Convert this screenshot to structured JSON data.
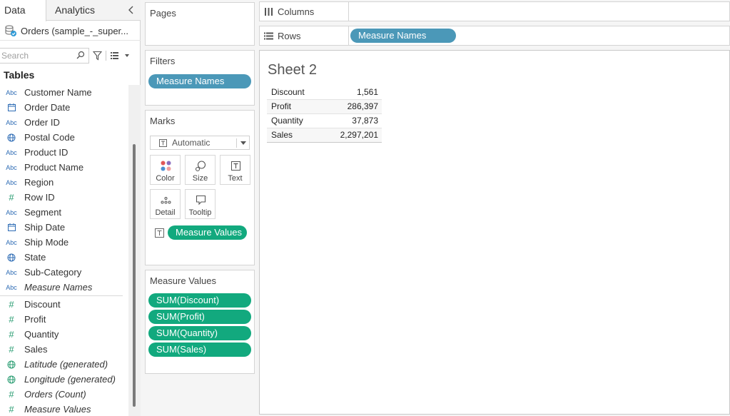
{
  "data_pane": {
    "tabs": [
      "Data",
      "Analytics"
    ],
    "datasource": "Orders (sample_-_super...",
    "search": {
      "placeholder": "Search"
    },
    "tables_title": "Tables",
    "dimensions": [
      {
        "icon": "Abc",
        "name": "Customer Name",
        "italic": false
      },
      {
        "icon": "date",
        "name": "Order Date",
        "italic": false
      },
      {
        "icon": "Abc",
        "name": "Order ID",
        "italic": false
      },
      {
        "icon": "globe",
        "name": "Postal Code",
        "italic": false
      },
      {
        "icon": "Abc",
        "name": "Product ID",
        "italic": false
      },
      {
        "icon": "Abc",
        "name": "Product Name",
        "italic": false
      },
      {
        "icon": "Abc",
        "name": "Region",
        "italic": false
      },
      {
        "icon": "#",
        "name": "Row ID",
        "italic": false
      },
      {
        "icon": "Abc",
        "name": "Segment",
        "italic": false
      },
      {
        "icon": "date",
        "name": "Ship Date",
        "italic": false
      },
      {
        "icon": "Abc",
        "name": "Ship Mode",
        "italic": false
      },
      {
        "icon": "globe",
        "name": "State",
        "italic": false
      },
      {
        "icon": "Abc",
        "name": "Sub-Category",
        "italic": false
      },
      {
        "icon": "Abc",
        "name": "Measure Names",
        "italic": true
      }
    ],
    "measures": [
      {
        "icon": "#",
        "name": "Discount",
        "italic": false
      },
      {
        "icon": "#",
        "name": "Profit",
        "italic": false
      },
      {
        "icon": "#",
        "name": "Quantity",
        "italic": false
      },
      {
        "icon": "#",
        "name": "Sales",
        "italic": false
      },
      {
        "icon": "globe",
        "name": "Latitude (generated)",
        "italic": true
      },
      {
        "icon": "globe",
        "name": "Longitude (generated)",
        "italic": true
      },
      {
        "icon": "#",
        "name": "Orders (Count)",
        "italic": true
      },
      {
        "icon": "#",
        "name": "Measure Values",
        "italic": true
      }
    ]
  },
  "pages": {
    "title": "Pages"
  },
  "filters": {
    "title": "Filters",
    "pills": [
      "Measure Names"
    ]
  },
  "marks": {
    "title": "Marks",
    "mark_type": "Automatic",
    "buttons": {
      "color": "Color",
      "size": "Size",
      "text": "Text",
      "detail": "Detail",
      "tooltip": "Tooltip"
    },
    "text_pill": "Measure Values"
  },
  "measure_values": {
    "title": "Measure Values",
    "pills": [
      "SUM(Discount)",
      "SUM(Profit)",
      "SUM(Quantity)",
      "SUM(Sales)"
    ]
  },
  "shelves": {
    "columns": {
      "label": "Columns",
      "pills": []
    },
    "rows": {
      "label": "Rows",
      "pills": [
        "Measure Names"
      ]
    }
  },
  "sheet": {
    "title": "Sheet 2",
    "rows": [
      {
        "label": "Discount",
        "value": "1,561"
      },
      {
        "label": "Profit",
        "value": "286,397"
      },
      {
        "label": "Quantity",
        "value": "37,873"
      },
      {
        "label": "Sales",
        "value": "2,297,201"
      }
    ]
  },
  "colors": {
    "dimension_pill": "#4b98b8",
    "measure_pill": "#12a97e"
  }
}
